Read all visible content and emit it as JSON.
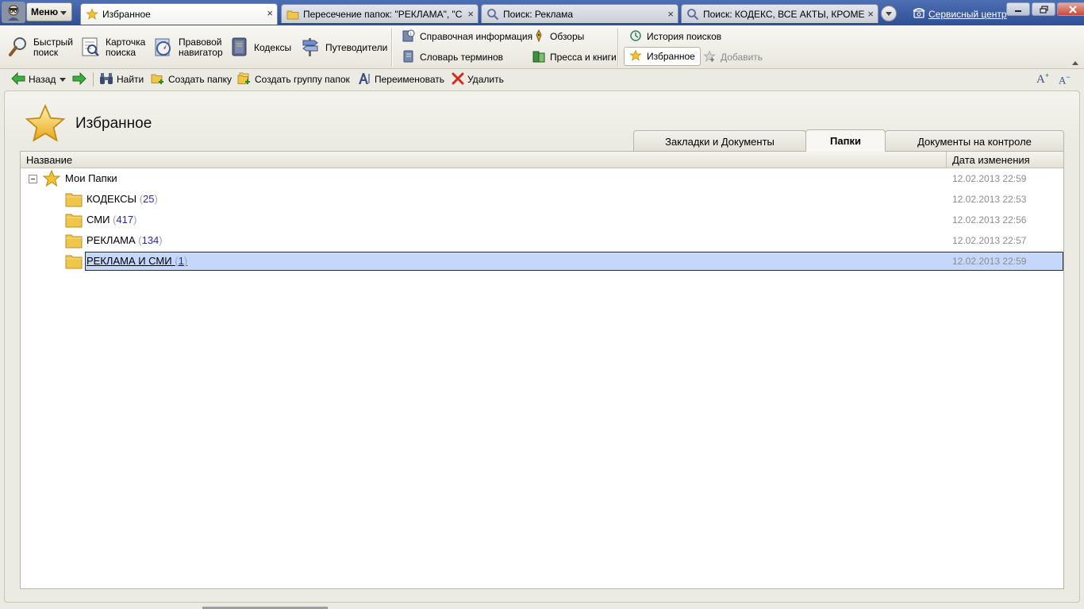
{
  "titlebar": {
    "menu_label": "Меню",
    "tabs": [
      {
        "label": "Избранное",
        "icon": "star-icon",
        "active": true
      },
      {
        "label": "Пересечение папок: \"РЕКЛАМА\", \"С...",
        "icon": "folder-icon"
      },
      {
        "label": "Поиск: Реклама",
        "icon": "search-icon"
      },
      {
        "label": "Поиск: КОДЕКС, ВСЕ АКТЫ, КРОМЕ ...",
        "icon": "search-icon"
      }
    ],
    "tab_close_glyph": "×",
    "service_center": "Сервисный центр"
  },
  "ribbon": {
    "quick_search": "Быстрый\nпоиск",
    "search_card": "Карточка\nпоиска",
    "legal_navigator": "Правовой\nнавигатор",
    "codes": "Кодексы",
    "guides": "Путеводители",
    "reference_info": "Справочная информация",
    "term_dictionary": "Словарь терминов",
    "reviews": "Обзоры",
    "press_books": "Пресса и книги",
    "search_history": "История поисков",
    "favorites": "Избранное",
    "add": "Добавить"
  },
  "toolbar": {
    "back": "Назад",
    "find": "Найти",
    "create_folder": "Создать папку",
    "create_group": "Создать группу папок",
    "rename": "Переименовать",
    "delete": "Удалить"
  },
  "page": {
    "title": "Избранное",
    "tabs": [
      {
        "label": "Закладки и Документы"
      },
      {
        "label": "Папки",
        "active": true
      },
      {
        "label": "Документы на контроле"
      }
    ]
  },
  "grid": {
    "col_name": "Название",
    "col_date": "Дата изменения",
    "root": {
      "label": "Мои Папки",
      "date": "12.02.2013 22:59"
    },
    "folders": [
      {
        "name": "КОДЕКСЫ",
        "count": "25",
        "date": "12.02.2013 22:53"
      },
      {
        "name": "СМИ",
        "count": "417",
        "date": "12.02.2013 22:56"
      },
      {
        "name": "РЕКЛАМА",
        "count": "134",
        "date": "12.02.2013 22:57"
      },
      {
        "name": "РЕКЛАМА И СМИ",
        "count": "1",
        "date": "12.02.2013 22:59",
        "selected": true
      }
    ]
  },
  "colors": {
    "titlebar": "#2f4f96",
    "selection": "#c5d7fb",
    "count_text": "#2a2aa8",
    "date_text": "#8c8c8c",
    "star": "#f2c230",
    "folder": "#f0c64a"
  }
}
